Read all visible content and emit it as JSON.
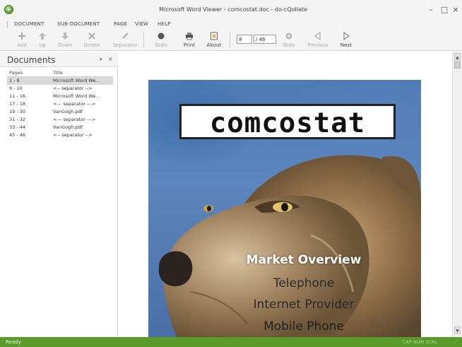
{
  "window": {
    "title": "Microsoft Word Viewer - comcostat.doc - do-cQollate"
  },
  "menu": {
    "items": [
      "DOCUMENT",
      "SUB-DOCUMENT",
      "PAGE",
      "VIEW",
      "HELP"
    ]
  },
  "toolbar": {
    "add": "Add",
    "up": "Up",
    "down": "Down",
    "delete": "Delete",
    "separator": "Separator",
    "goto_left": "Goto",
    "print": "Print",
    "about": "About",
    "page_value": "8",
    "page_total": "/ 46",
    "goto": "Goto",
    "previous": "Previous",
    "next": "Next"
  },
  "documents_panel": {
    "title": "Documents",
    "pin_icon": "▾",
    "close_icon": "×",
    "columns": {
      "pages": "Pages",
      "title": "Title"
    },
    "rows": [
      {
        "pages": "1 - 8",
        "title": "Microsoft Word We...",
        "selected": true
      },
      {
        "pages": "9 - 10",
        "title": "<-- separator -->",
        "selected": false
      },
      {
        "pages": "11 - 16",
        "title": "Microsoft Word We...",
        "selected": false
      },
      {
        "pages": "17 - 18",
        "title": "<--- separator --->",
        "selected": false
      },
      {
        "pages": "19 - 30",
        "title": "VanGogh.pdf",
        "selected": false
      },
      {
        "pages": "31 - 32",
        "title": "<--- separator --->",
        "selected": false
      },
      {
        "pages": "33 - 44",
        "title": "VanGogh.pdf",
        "selected": false
      },
      {
        "pages": "45 - 46",
        "title": "<-- separator -->",
        "selected": false
      }
    ]
  },
  "document": {
    "logo": "comcostat",
    "headline": "Market Overview",
    "lines": [
      "Telephone",
      "Internet Provider",
      "Mobile Phone"
    ]
  },
  "statusbar": {
    "text": "Ready",
    "keys": "CAP NUM SCRL"
  },
  "colors": {
    "status_green": "#5a9a2a",
    "selected_row": "#d9d9d9",
    "page_blue": "#4d79b3"
  }
}
